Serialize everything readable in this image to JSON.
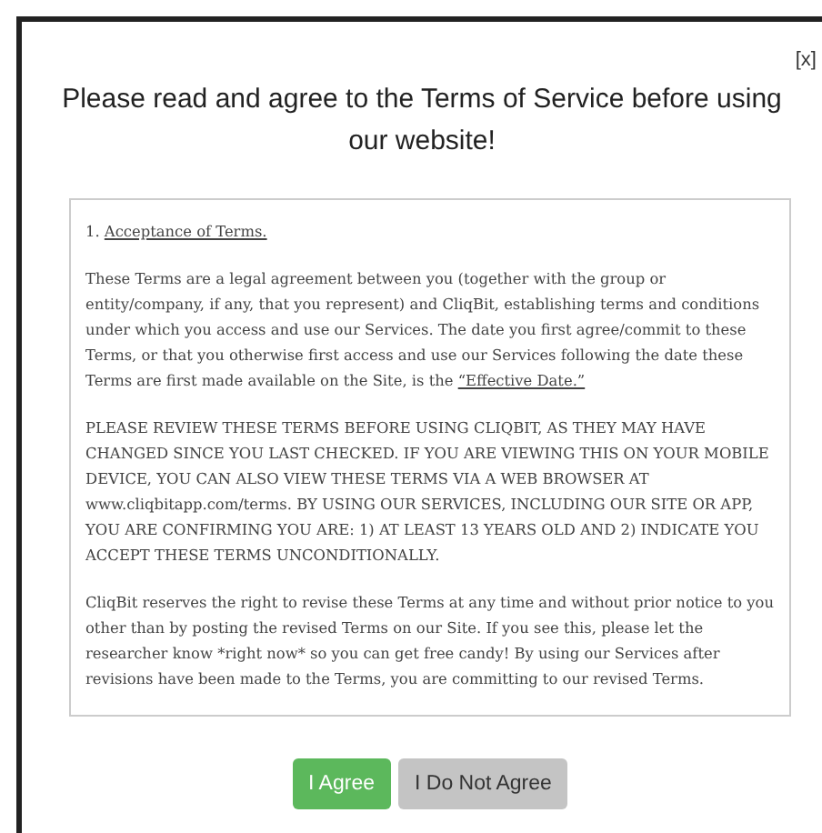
{
  "dialog": {
    "close": "[x]",
    "title": "Please read and agree to the Terms of Service before using our website!"
  },
  "terms": {
    "section_number": "1.",
    "section_title": "Acceptance of Terms.",
    "paragraphs": [
      {
        "kind": "linked",
        "text": "These Terms are a legal agreement between you (together with the group or entity/company, if any, that you represent) and CliqBit, establishing terms and conditions under which you access and use our Services. The date you first agree/commit to these Terms, or that you otherwise first access and use our Services following the date these Terms are first made available on the Site, is the",
        "link": "“Effective Date.”"
      },
      {
        "kind": "plain",
        "text": "PLEASE REVIEW THESE TERMS BEFORE USING CLIQBIT, AS THEY MAY HAVE CHANGED SINCE YOU LAST CHECKED. IF YOU ARE VIEWING THIS ON YOUR MOBILE DEVICE, YOU CAN ALSO VIEW THESE TERMS VIA A WEB BROWSER AT www.cliqbitapp.com/terms. BY USING OUR SERVICES, INCLUDING OUR SITE OR APP, YOU ARE CONFIRMING YOU ARE: 1) AT LEAST 13 YEARS OLD AND 2) INDICATE YOU ACCEPT THESE TERMS UNCONDITIONALLY."
      },
      {
        "kind": "plain",
        "text": "CliqBit reserves the right to revise these Terms at any time and without prior notice to you other than by posting the revised Terms on our Site. If you see this, please let the researcher know *right now* so you can get free candy! By using our Services after revisions have been made to the Terms, you are committing to our revised Terms."
      }
    ]
  },
  "buttons": [
    {
      "kind": "primary",
      "label": "I Agree"
    },
    {
      "kind": "secondary",
      "label": "I Do Not Agree"
    }
  ]
}
